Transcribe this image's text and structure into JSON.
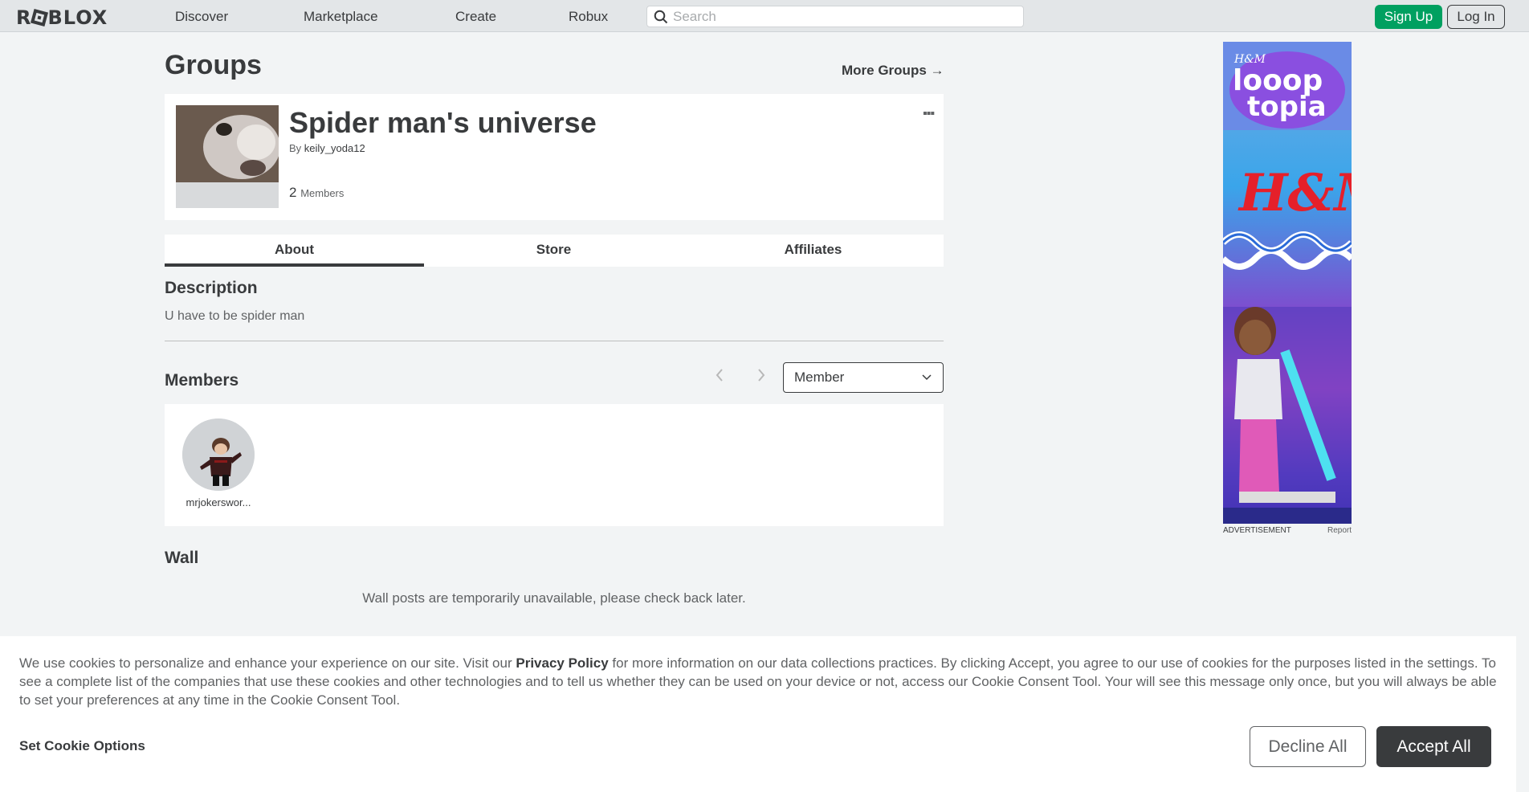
{
  "nav": {
    "logo": "ROBLOX",
    "links": [
      "Discover",
      "Marketplace",
      "Create",
      "Robux"
    ],
    "search_placeholder": "Search",
    "signup_label": "Sign Up",
    "login_label": "Log In"
  },
  "page": {
    "title": "Groups",
    "more_groups": "More Groups →"
  },
  "group": {
    "name": "Spider man's universe",
    "by_prefix": "By",
    "owner": "keily_yoda12",
    "member_count": "2",
    "members_label": "Members",
    "menu_glyph": "▪▪▪"
  },
  "tabs": [
    {
      "label": "About",
      "active": true
    },
    {
      "label": "Store",
      "active": false
    },
    {
      "label": "Affiliates",
      "active": false
    }
  ],
  "about": {
    "description_heading": "Description",
    "description_text": "U have to be spider man",
    "members_heading": "Members",
    "role_selected": "Member",
    "members": [
      {
        "name": "mrjokerswor..."
      }
    ],
    "wall_heading": "Wall",
    "wall_message": "Wall posts are temporarily unavailable, please check back later."
  },
  "ad": {
    "label": "ADVERTISEMENT",
    "report": "Report",
    "brand_small": "H&M",
    "headline_1": "looop",
    "headline_2": "topia",
    "brand_large": "H&M"
  },
  "cookie": {
    "text_before": "We use cookies to personalize and enhance your experience on our site. Visit our ",
    "link": "Privacy Policy",
    "text_after": " for more information on our data collections practices. By clicking Accept, you agree to our use of cookies for the purposes listed in the settings. To see a complete list of the companies that use these cookies and other technologies and to tell us whether they can be used on your device or not, access our Cookie Consent Tool. Your will see this message only once, but you will always be able to set your preferences at any time in the Cookie Consent Tool.",
    "options_label": "Set Cookie Options",
    "decline_label": "Decline All",
    "accept_label": "Accept All"
  },
  "colors": {
    "signup_green": "#00a060",
    "text_dark": "#393b3d",
    "background": "#f2f4f5"
  }
}
